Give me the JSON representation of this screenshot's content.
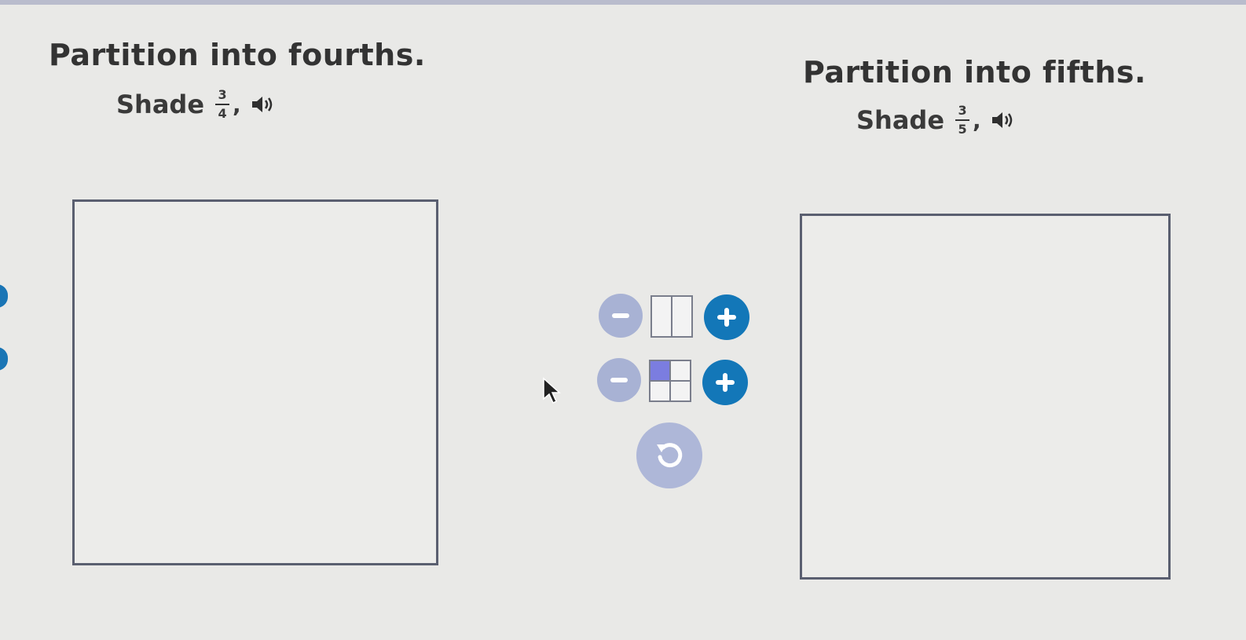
{
  "left_task": {
    "title": "Partition into fourths.",
    "shade_word": "Shade",
    "numerator": "3",
    "denominator": "4",
    "punct": ","
  },
  "right_task": {
    "title": "Partition into fifths.",
    "shade_word": "Shade",
    "numerator": "3",
    "denominator": "5",
    "punct": ","
  },
  "icons": {
    "speaker": "speaker-icon",
    "minus": "minus-icon",
    "plus": "plus-icon",
    "reset": "reset-icon"
  },
  "colors": {
    "accent_blue": "#1377b8",
    "disabled_blue": "#a8b2d4",
    "shade_purple": "#7b7de0",
    "box_border": "#5a5f70"
  }
}
